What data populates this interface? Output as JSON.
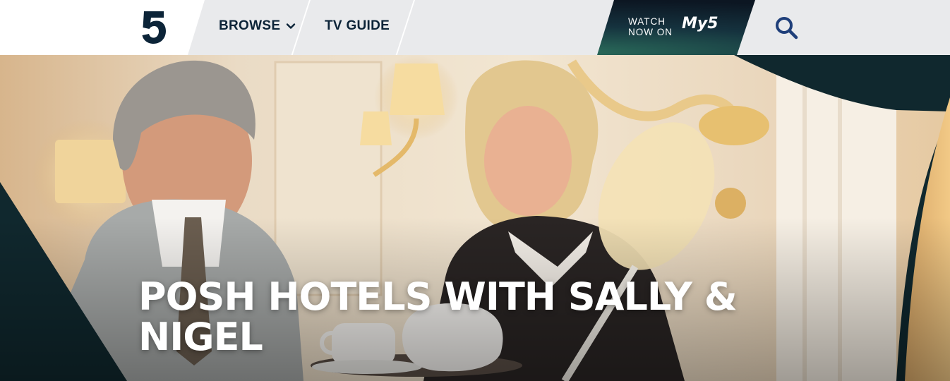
{
  "header": {
    "logo": {
      "icon": "channel5-logo-icon"
    },
    "nav": [
      {
        "label": "BROWSE",
        "icon": "chevron-down-icon"
      },
      {
        "label": "TV GUIDE"
      }
    ],
    "promo": {
      "line1": "WATCH",
      "line2": "NOW ON",
      "logo_text": "My5"
    },
    "search": {
      "icon": "search-icon"
    }
  },
  "hero": {
    "title": "POSH HOTELS WITH SALLY & NIGEL"
  },
  "colors": {
    "navy": "#0c2438",
    "header_grey": "#e9eaec",
    "hero_dark": "#10282e",
    "search_blue": "#1f3f7a"
  }
}
